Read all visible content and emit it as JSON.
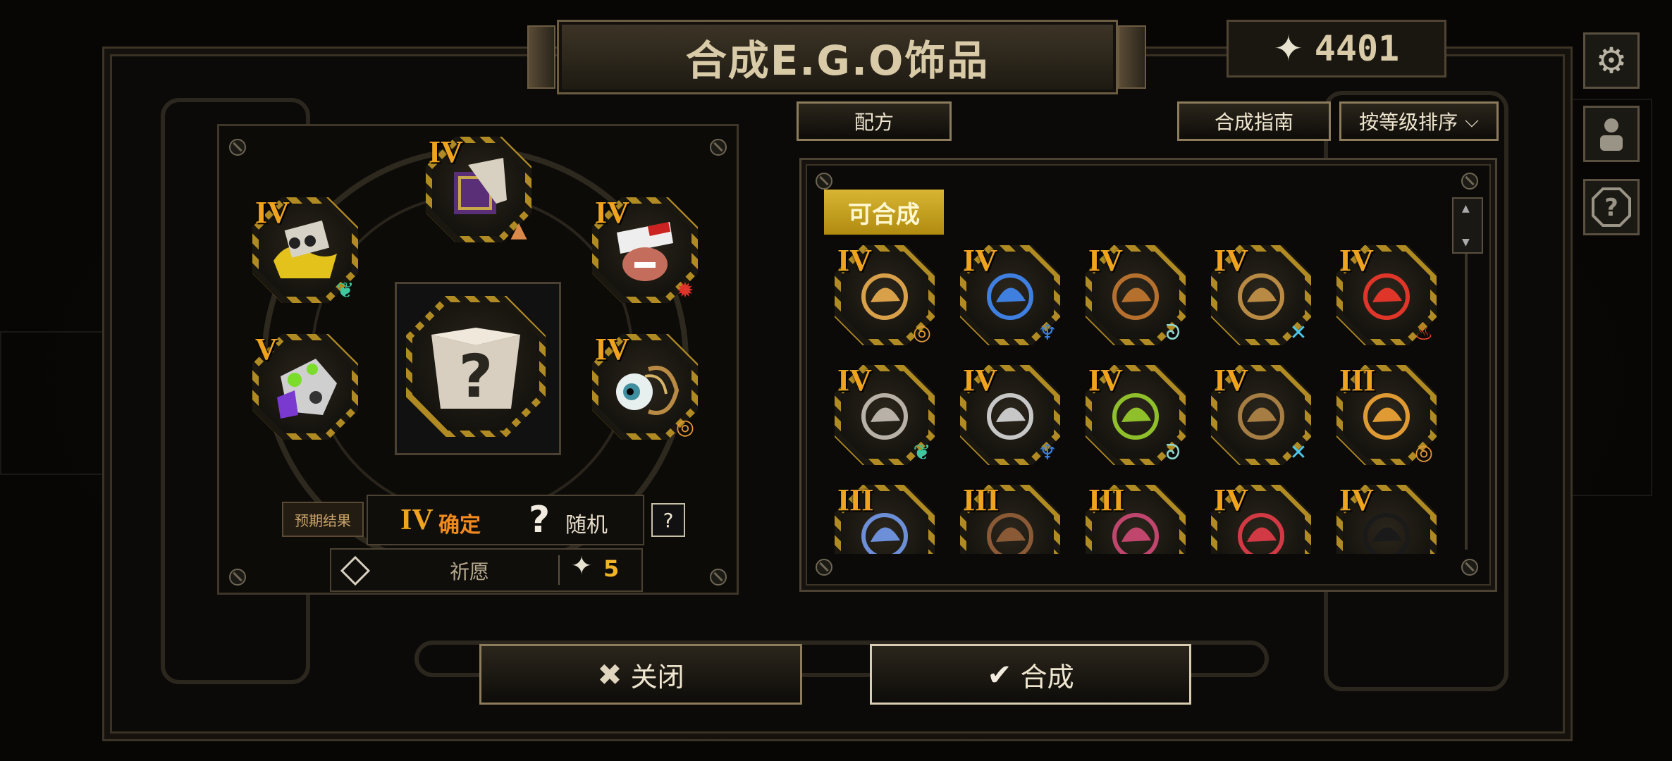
{
  "title": "合成E.G.O饰品",
  "currency": {
    "icon": "four-point-star-icon",
    "value": "4401"
  },
  "buttons": {
    "recipe": "配方",
    "guide": "合成指南",
    "sort": "按等级排序",
    "close": "关闭",
    "craft": "合成"
  },
  "side_icons": [
    "gear-icon",
    "profile-icon",
    "help-icon"
  ],
  "input_slots": [
    {
      "level": "IV",
      "badge": "green-leaf-icon",
      "art": "yellow"
    },
    {
      "level": "IV",
      "badge": "orange-arrow-icon",
      "art": "purple"
    },
    {
      "level": "IV",
      "badge": "red-splash-icon",
      "art": "red"
    },
    {
      "level": "V",
      "badge": "",
      "art": "green"
    },
    {
      "level": "IV",
      "badge": "orange-ring-icon",
      "art": "eye"
    }
  ],
  "center_slot": {
    "icon": "question-box-icon",
    "text": "?"
  },
  "expected_result": {
    "label": "预期结果",
    "level": "IV",
    "certain": "确定",
    "random_icon": "?",
    "random": "随机",
    "help": "?"
  },
  "wish": {
    "label": "祈愿",
    "cost": "5"
  },
  "available_tag": "可合成",
  "ego_items": [
    {
      "level": "IV",
      "color": "#d9a04a",
      "badge": "orange-ring-icon"
    },
    {
      "level": "IV",
      "color": "#3f7fe0",
      "badge": "blue-mask-icon"
    },
    {
      "level": "IV",
      "color": "#b5702e",
      "badge": "teal-swirl-icon"
    },
    {
      "level": "IV",
      "color": "#b88a44",
      "badge": "cyan-cross-icon"
    },
    {
      "level": "IV",
      "color": "#e0362a",
      "badge": "fire-icon"
    },
    {
      "level": "IV",
      "color": "#b7b1a8",
      "badge": "green-leaf-icon"
    },
    {
      "level": "IV",
      "color": "#c7c7c7",
      "badge": "blue-mask-icon"
    },
    {
      "level": "IV",
      "color": "#8fbf2a",
      "badge": "teal-swirl-icon"
    },
    {
      "level": "IV",
      "color": "#a67e44",
      "badge": "cyan-cross-icon"
    },
    {
      "level": "III",
      "color": "#e09a34",
      "badge": "orange-ring-icon"
    },
    {
      "level": "III",
      "color": "#6d8fd8",
      "badge": ""
    },
    {
      "level": "III",
      "color": "#8a5a36",
      "badge": ""
    },
    {
      "level": "III",
      "color": "#c0466e",
      "badge": ""
    },
    {
      "level": "IV",
      "color": "#d13a44",
      "badge": ""
    },
    {
      "level": "IV",
      "color": "#1a1a1a",
      "badge": ""
    }
  ],
  "colors": {
    "accent_gold": "#f0a41e",
    "tag_gold": "#d8b532",
    "frame": "#3b3326"
  }
}
